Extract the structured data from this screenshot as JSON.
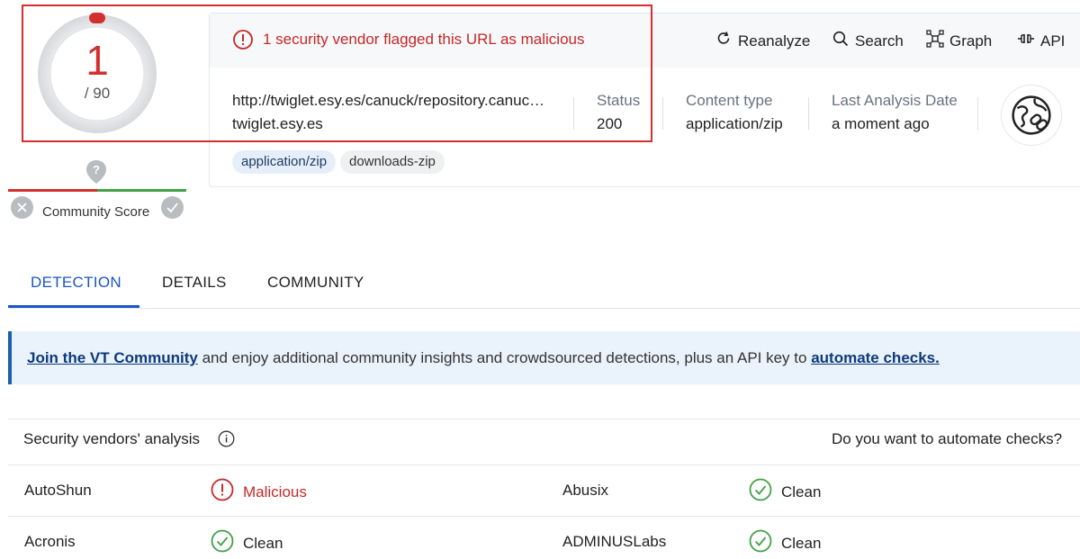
{
  "score": {
    "detections": "1",
    "total": "/ 90"
  },
  "alert": {
    "text": "1 security vendor flagged this URL as malicious",
    "icon": "alert-circle-icon"
  },
  "actions": [
    {
      "label": "Reanalyze",
      "icon": "refresh-icon"
    },
    {
      "label": "Search",
      "icon": "search-icon"
    },
    {
      "label": "Graph",
      "icon": "graph-icon"
    },
    {
      "label": "API",
      "icon": "api-icon"
    }
  ],
  "target": {
    "url": "http://twiglet.esy.es/canuck/repository.canuck.zip",
    "domain": "twiglet.esy.es"
  },
  "meta": {
    "status_label": "Status",
    "status_value": "200",
    "content_type_label": "Content type",
    "content_type_value": "application/zip",
    "last_analysis_label": "Last Analysis Date",
    "last_analysis_value": "a moment ago"
  },
  "tags": [
    "application/zip",
    "downloads-zip"
  ],
  "community": {
    "label": "Community Score"
  },
  "tabs": [
    "DETECTION",
    "DETAILS",
    "COMMUNITY"
  ],
  "banner": {
    "link1": "Join the VT Community",
    "middle": " and enjoy additional community insights and crowdsourced detections, plus an API key to ",
    "link2": "automate checks."
  },
  "vendors_table": {
    "title": "Security vendors' analysis",
    "automate_prompt": "Do you want to automate checks?",
    "rows": [
      {
        "left_vendor": "AutoShun",
        "left_verdict": "Malicious",
        "right_vendor": "Abusix",
        "right_verdict": "Clean"
      },
      {
        "left_vendor": "Acronis",
        "left_verdict": "Clean",
        "right_vendor": "ADMINUSLabs",
        "right_verdict": "Clean"
      }
    ]
  },
  "colors": {
    "malicious": "#c62828",
    "clean": "#43a047",
    "accent": "#1a56c4"
  }
}
